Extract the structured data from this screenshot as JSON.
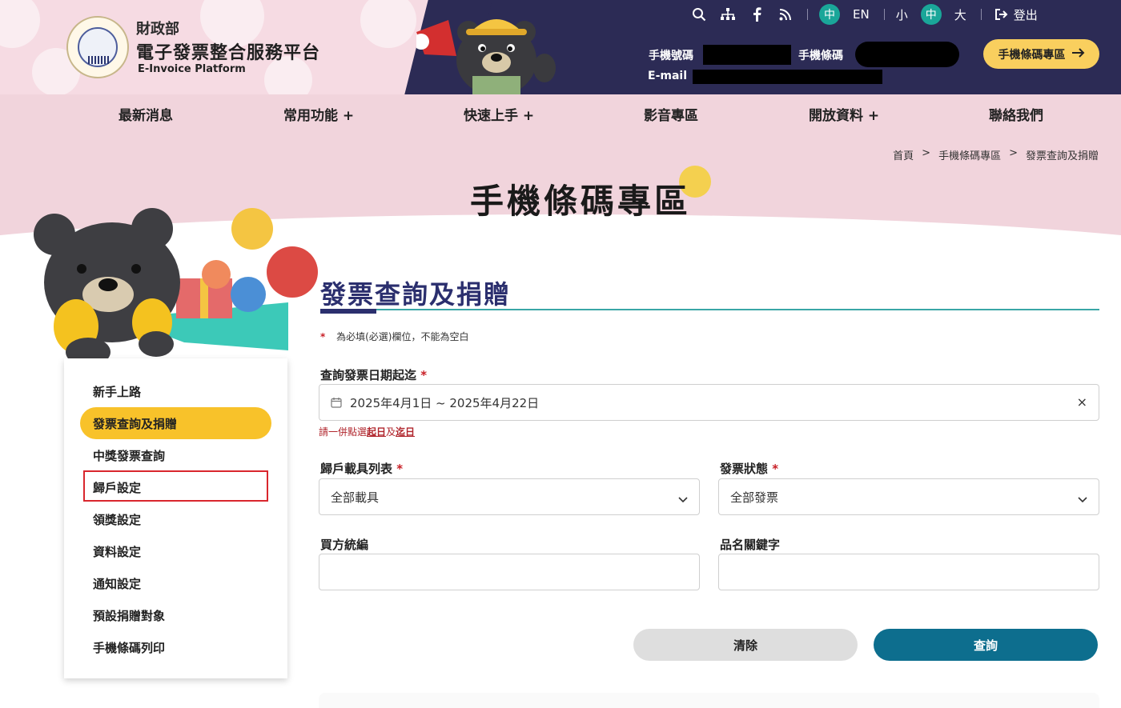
{
  "header": {
    "ministry": "財政部",
    "platform_title": "電子發票整合服務平台",
    "platform_sub": "E-Invoice Platform",
    "utility": {
      "lang_zh": "中",
      "lang_en": "EN",
      "font_small": "小",
      "font_medium": "中",
      "font_large": "大",
      "logout": "登出"
    },
    "account": {
      "phone_label": "手機號碼",
      "barcode_label": "手機條碼",
      "email_label": "E-mail"
    },
    "barcode_button": "手機條碼專區"
  },
  "nav": {
    "items": [
      "最新消息",
      "常用功能 +",
      "快速上手 +",
      "影音專區",
      "開放資料 +",
      "聯絡我們"
    ]
  },
  "breadcrumb": [
    "首頁",
    ">",
    "手機條碼專區",
    ">",
    "發票查詢及捐贈"
  ],
  "page_title": "手機條碼專區",
  "sidebar": {
    "items": [
      "新手上路",
      "發票查詢及捐贈",
      "中獎發票查詢",
      "歸戶設定",
      "領獎設定",
      "資料設定",
      "通知設定",
      "預設捐贈對象",
      "手機條碼列印"
    ],
    "active": "發票查詢及捐贈"
  },
  "form": {
    "title": "發票查詢及捐贈",
    "required_mark": "*",
    "required_note": "為必填(必選)欄位，不能為空白",
    "date_label": "查詢發票日期起迄",
    "date_value": "2025年4月1日 ~ 2025年4月22日",
    "date_clear": "×",
    "hint_prefix": "請一併點選",
    "hint_start": "起日",
    "hint_and": "及",
    "hint_end": "迄日",
    "carrier_label": "歸戶載具列表",
    "carrier_value": "全部載具",
    "status_label": "發票狀態",
    "status_value": "全部發票",
    "buyer_label": "買方統編",
    "buyer_value": "",
    "keyword_label": "品名關鍵字",
    "keyword_value": "",
    "clear_button": "清除",
    "query_button": "查詢"
  },
  "colors": {
    "header_dark": "#2c2b55",
    "pink": "#f1d4dc",
    "accent_yellow": "#f9cf5e",
    "teal": "#1aa699",
    "query_blue": "#0d6e8e",
    "title_navy": "#2b2f6e",
    "required_red": "#c81e25"
  }
}
